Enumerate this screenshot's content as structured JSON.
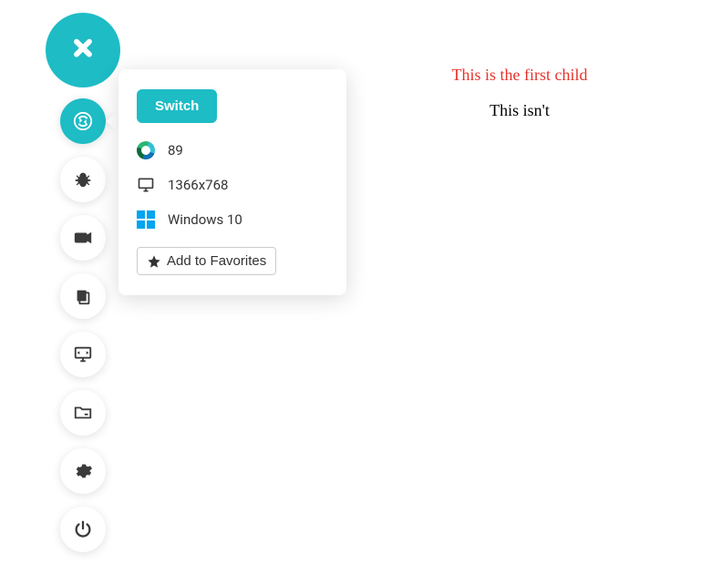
{
  "panel": {
    "switch_label": "Switch",
    "browser": {
      "name": "Edge",
      "version": "89"
    },
    "resolution": "1366x768",
    "os": "Windows 10",
    "favorite_label": "Add to Favorites"
  },
  "content": {
    "first_child": "This is the first child",
    "not_first": "This isn't"
  },
  "colors": {
    "accent": "#1ebcc5",
    "first_child_text": "#e6332a"
  }
}
